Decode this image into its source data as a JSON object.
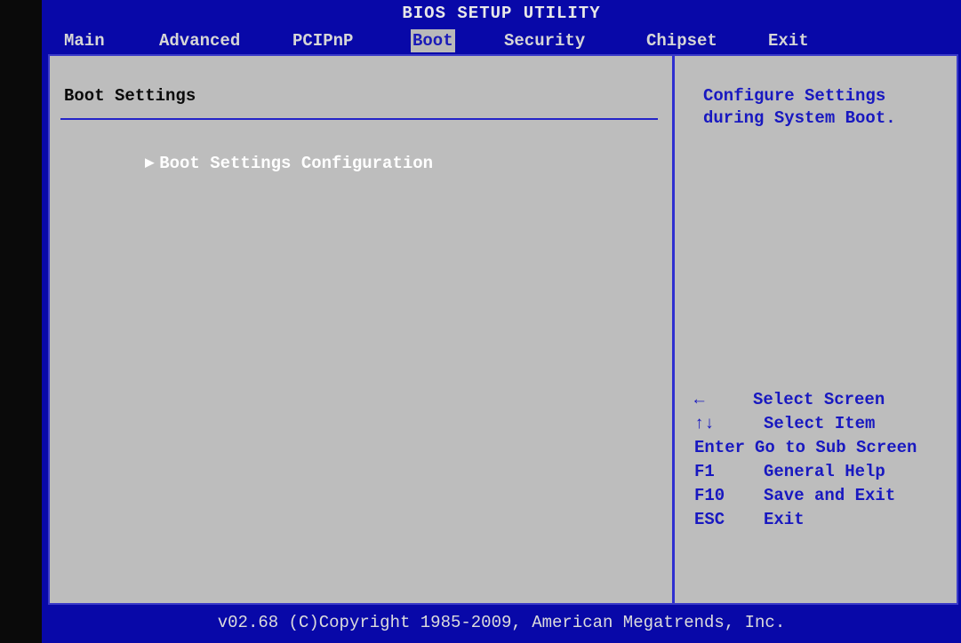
{
  "title": "BIOS SETUP UTILITY",
  "tabs": [
    {
      "label": "Main"
    },
    {
      "label": "Advanced"
    },
    {
      "label": "PCIPnP"
    },
    {
      "label": "Boot"
    },
    {
      "label": "Security"
    },
    {
      "label": "Chipset"
    },
    {
      "label": "Exit"
    }
  ],
  "active_tab": "Boot",
  "main": {
    "heading": "Boot Settings",
    "items": [
      {
        "label": "Boot Settings Configuration",
        "icon": "submenu-arrow-icon"
      }
    ]
  },
  "help": {
    "line1": "Configure Settings",
    "line2": "during System Boot."
  },
  "keys": [
    {
      "key": "←",
      "desc": "Select Screen"
    },
    {
      "key": "↑↓",
      "desc": "Select Item"
    },
    {
      "key": "Enter",
      "desc": "Go to Sub Screen"
    },
    {
      "key": "F1",
      "desc": "General Help"
    },
    {
      "key": "F10",
      "desc": "Save and Exit"
    },
    {
      "key": "ESC",
      "desc": "Exit"
    }
  ],
  "footer": "v02.68 (C)Copyright 1985-2009, American Megatrends, Inc.",
  "colors": {
    "background_blue": "#0808a8",
    "panel_gray": "#bdbdbd",
    "help_text_blue": "#1818c0",
    "active_tab_bg": "#b9b9b9"
  }
}
